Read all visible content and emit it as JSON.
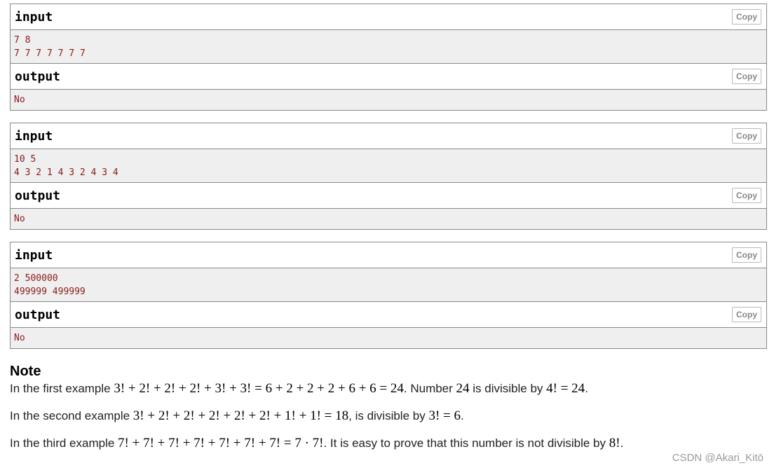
{
  "samples": [
    {
      "input_title": "input",
      "input_lines": [
        "7 8",
        "7 7 7 7 7 7 7"
      ],
      "output_title": "output",
      "output_lines": [
        "No"
      ],
      "copy_label": "Copy"
    },
    {
      "input_title": "input",
      "input_lines": [
        "10 5",
        "4 3 2 1 4 3 2 4 3 4"
      ],
      "output_title": "output",
      "output_lines": [
        "No"
      ],
      "copy_label": "Copy"
    },
    {
      "input_title": "input",
      "input_lines": [
        "2 500000",
        "499999 499999"
      ],
      "output_title": "output",
      "output_lines": [
        "No"
      ],
      "copy_label": "Copy"
    }
  ],
  "note": {
    "title": "Note",
    "line1": {
      "pre": "In the first example ",
      "math1": "3! + 2! + 2! + 2! + 3! + 3! = 6 + 2 + 2 + 2 + 6 + 6 = 24",
      "mid1": ". Number ",
      "math2": "24",
      "mid2": " is divisible by ",
      "math3": "4! = 24",
      "post": "."
    },
    "line2": {
      "pre": "In the second example ",
      "math1": "3! + 2! + 2! + 2! + 2! + 2! + 1! + 1! = 18",
      "mid1": ", is divisible by ",
      "math2": "3! = 6",
      "post": "."
    },
    "line3": {
      "pre": "In the third example ",
      "math1": "7! + 7! + 7! + 7! + 7! + 7! + 7! = 7 · 7!",
      "mid1": ". It is easy to prove that this number is not divisible by ",
      "math2": "8!",
      "post": "."
    }
  },
  "watermark": "CSDN @Akari_Kitō"
}
